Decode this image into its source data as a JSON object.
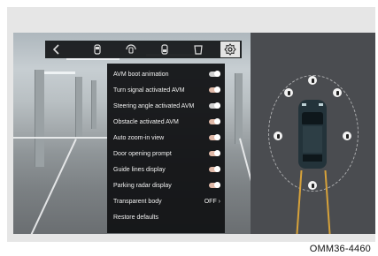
{
  "icon_bar": {
    "items": [
      {
        "name": "back-icon",
        "glyph": "‹",
        "active": false
      },
      {
        "name": "car-front-icon",
        "active": false
      },
      {
        "name": "car-rotate-icon",
        "active": false
      },
      {
        "name": "car-side-icon",
        "active": false
      },
      {
        "name": "car-rear-icon",
        "active": false
      },
      {
        "name": "settings-gear-icon",
        "active": true
      }
    ]
  },
  "menu": {
    "items": [
      {
        "label": "AVM boot animation",
        "control": "toggle",
        "state": "grey"
      },
      {
        "label": "Turn signal activated AVM",
        "control": "toggle",
        "state": "on"
      },
      {
        "label": "Steering angle activated AVM",
        "control": "toggle",
        "state": "grey"
      },
      {
        "label": "Obstacle activated AVM",
        "control": "toggle",
        "state": "on"
      },
      {
        "label": "Auto zoom-in view",
        "control": "toggle",
        "state": "on"
      },
      {
        "label": "Door opening prompt",
        "control": "toggle",
        "state": "on"
      },
      {
        "label": "Guide lines display",
        "control": "toggle",
        "state": "on"
      },
      {
        "label": "Parking radar display",
        "control": "toggle",
        "state": "on"
      },
      {
        "label": "Transparent body",
        "control": "value",
        "value": "OFF ›"
      },
      {
        "label": "Restore defaults",
        "control": "none"
      }
    ]
  },
  "colors": {
    "toggle_on": "#e0b9a8",
    "toggle_grey": "#d0d0d0",
    "guide_line": "#d7a23a"
  },
  "caption": "OMM36-4460"
}
